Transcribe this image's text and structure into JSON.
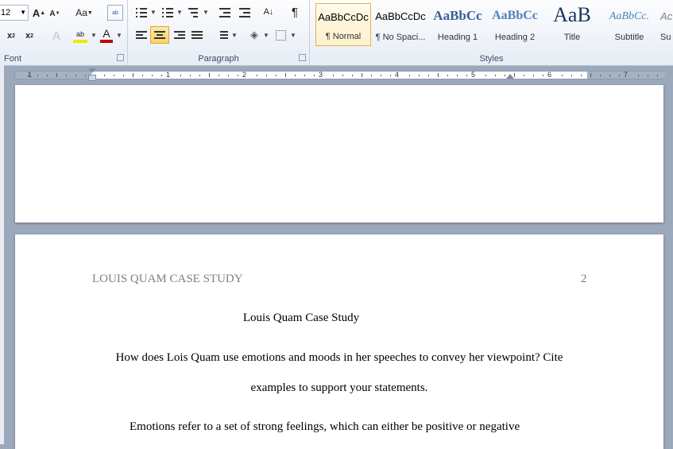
{
  "font": {
    "size_value": "12",
    "group_label": "Font"
  },
  "paragraph": {
    "group_label": "Paragraph",
    "pilcrow": "¶"
  },
  "styles": {
    "group_label": "Styles",
    "items": [
      {
        "sample": "AaBbCcDc",
        "name": "¶ Normal",
        "selected": true
      },
      {
        "sample": "AaBbCcDc",
        "name": "¶ No Spaci..."
      },
      {
        "sample": "AaBbCc",
        "name": "Heading 1"
      },
      {
        "sample": "AaBbCc",
        "name": "Heading 2"
      },
      {
        "sample": "AaB",
        "name": "Title"
      },
      {
        "sample": "AaBbCc.",
        "name": "Subtitle"
      },
      {
        "sample": "Ac",
        "name": "Su"
      }
    ]
  },
  "ruler": {
    "numbers": [
      "1",
      "1",
      "2",
      "3",
      "4",
      "5",
      "6",
      "7"
    ]
  },
  "document": {
    "header_title": "LOUIS QUAM CASE STUDY",
    "page_number": "2",
    "title": "Louis Quam Case Study",
    "question_line1": "How does Lois Quam use emotions and moods in her speeches to convey her viewpoint? Cite",
    "question_line2": "examples to support your statements.",
    "body_line1": "Emotions refer to a set of strong feelings, which can either be positive or negative"
  },
  "colors": {
    "highlight": "#f5e400",
    "font_color": "#c00000",
    "selected_tile": "#fde9a8"
  }
}
